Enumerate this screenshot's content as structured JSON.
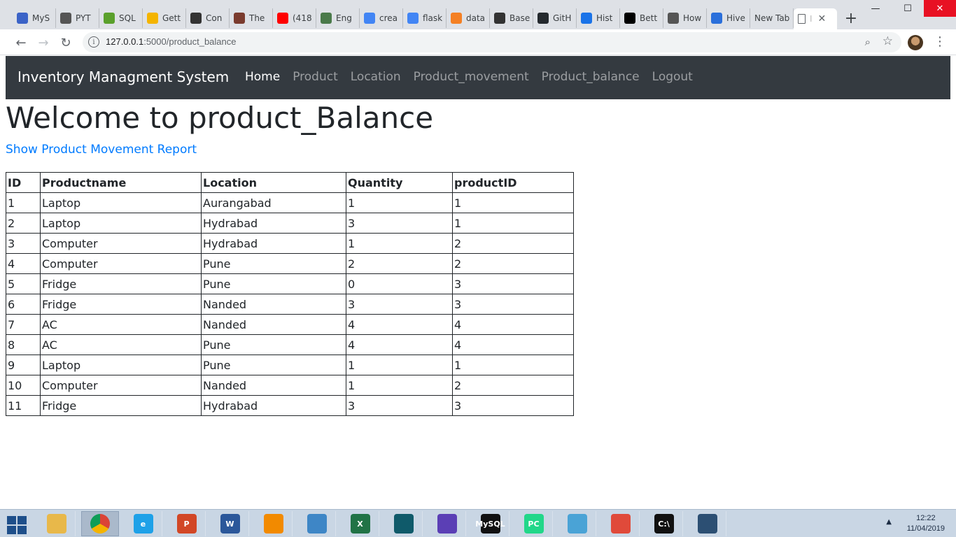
{
  "browser": {
    "tabs": [
      {
        "label": "MyS",
        "icon": "atom-icon",
        "color": "#3b63c7"
      },
      {
        "label": "PYT",
        "icon": "book-icon",
        "color": "#555555"
      },
      {
        "label": "SQL",
        "icon": "sql-icon",
        "color": "#5aa02c"
      },
      {
        "label": "Gett",
        "icon": "drive-icon",
        "color": "#f4b400"
      },
      {
        "label": "Con",
        "icon": "phone-icon",
        "color": "#333333"
      },
      {
        "label": "The",
        "icon": "portrait-icon",
        "color": "#7a3b2e"
      },
      {
        "label": "(418",
        "icon": "youtube-icon",
        "color": "#ff0000"
      },
      {
        "label": "Eng",
        "icon": "target-icon",
        "color": "#4a7a4a"
      },
      {
        "label": "crea",
        "icon": "google-icon",
        "color": "#4285f4"
      },
      {
        "label": "flask",
        "icon": "google-icon",
        "color": "#4285f4"
      },
      {
        "label": "data",
        "icon": "stackoverflow-icon",
        "color": "#f48024"
      },
      {
        "label": "Base",
        "icon": "columns-icon",
        "color": "#333333"
      },
      {
        "label": "GitH",
        "icon": "github-icon",
        "color": "#24292e"
      },
      {
        "label": "Hist",
        "icon": "history-icon",
        "color": "#1a73e8"
      },
      {
        "label": "Bett",
        "icon": "medium-icon",
        "color": "#000000"
      },
      {
        "label": "How",
        "icon": "user-icon",
        "color": "#555555"
      },
      {
        "label": "Hive",
        "icon": "bars-icon",
        "color": "#2a6fdb"
      },
      {
        "label": "New Tab",
        "icon": "",
        "color": ""
      }
    ],
    "active_tab": {
      "label": "I",
      "close": "✕"
    },
    "new_tab": "+",
    "window_controls": {
      "minimize": "—",
      "maximize": "☐",
      "close": "✕"
    },
    "url_host": "127.0.0.1",
    "url_rest": ":5000/product_balance"
  },
  "navbar": {
    "brand": "Inventory Managment System",
    "links": [
      "Home",
      "Product",
      "Location",
      "Product_movement",
      "Product_balance",
      "Logout"
    ],
    "active": "Home"
  },
  "main": {
    "title": "Welcome to product_Balance",
    "report_link": "Show Product Movement Report"
  },
  "table": {
    "headers": [
      "ID",
      "Productname",
      "Location",
      "Quantity",
      "productID"
    ],
    "rows": [
      [
        "1",
        "Laptop",
        "Aurangabad",
        "1",
        "1"
      ],
      [
        "2",
        "Laptop",
        "Hydrabad",
        "3",
        "1"
      ],
      [
        "3",
        "Computer",
        "Hydrabad",
        "1",
        "2"
      ],
      [
        "4",
        "Computer",
        "Pune",
        "2",
        "2"
      ],
      [
        "5",
        "Fridge",
        "Pune",
        "0",
        "3"
      ],
      [
        "6",
        "Fridge",
        "Nanded",
        "3",
        "3"
      ],
      [
        "7",
        "AC",
        "Nanded",
        "4",
        "4"
      ],
      [
        "8",
        "AC",
        "Pune",
        "4",
        "4"
      ],
      [
        "9",
        "Laptop",
        "Pune",
        "1",
        "1"
      ],
      [
        "10",
        "Computer",
        "Nanded",
        "1",
        "2"
      ],
      [
        "11",
        "Fridge",
        "Hydrabad",
        "3",
        "3"
      ]
    ]
  },
  "taskbar": {
    "apps": [
      {
        "name": "file-explorer-icon",
        "color": "#e8b84a",
        "label": ""
      },
      {
        "name": "chrome-icon",
        "color": "#db4437",
        "label": ""
      },
      {
        "name": "internet-explorer-icon",
        "color": "#1ea1e8",
        "label": "e"
      },
      {
        "name": "powerpoint-icon",
        "color": "#d24726",
        "label": "P"
      },
      {
        "name": "word-icon",
        "color": "#2b579a",
        "label": "W"
      },
      {
        "name": "vlc-icon",
        "color": "#f28a00",
        "label": ""
      },
      {
        "name": "network-icon",
        "color": "#3e86c6",
        "label": ""
      },
      {
        "name": "excel-icon",
        "color": "#217346",
        "label": "X"
      },
      {
        "name": "book-app-icon",
        "color": "#0f5a6a",
        "label": ""
      },
      {
        "name": "audio-icon",
        "color": "#5b3fb5",
        "label": ""
      },
      {
        "name": "mysql-console-icon",
        "color": "#111111",
        "label": "MySQL"
      },
      {
        "name": "pycharm-icon",
        "color": "#21d789",
        "label": "PC"
      },
      {
        "name": "notepad-icon",
        "color": "#4aa3d6",
        "label": ""
      },
      {
        "name": "colorful-app-icon",
        "color": "#e04a3a",
        "label": ""
      },
      {
        "name": "command-prompt-icon",
        "color": "#111111",
        "label": "C:\\"
      },
      {
        "name": "mysql-workbench-icon",
        "color": "#2c4f73",
        "label": ""
      }
    ],
    "active_app": "chrome-icon",
    "time": "12:22",
    "date": "11/04/2019"
  }
}
